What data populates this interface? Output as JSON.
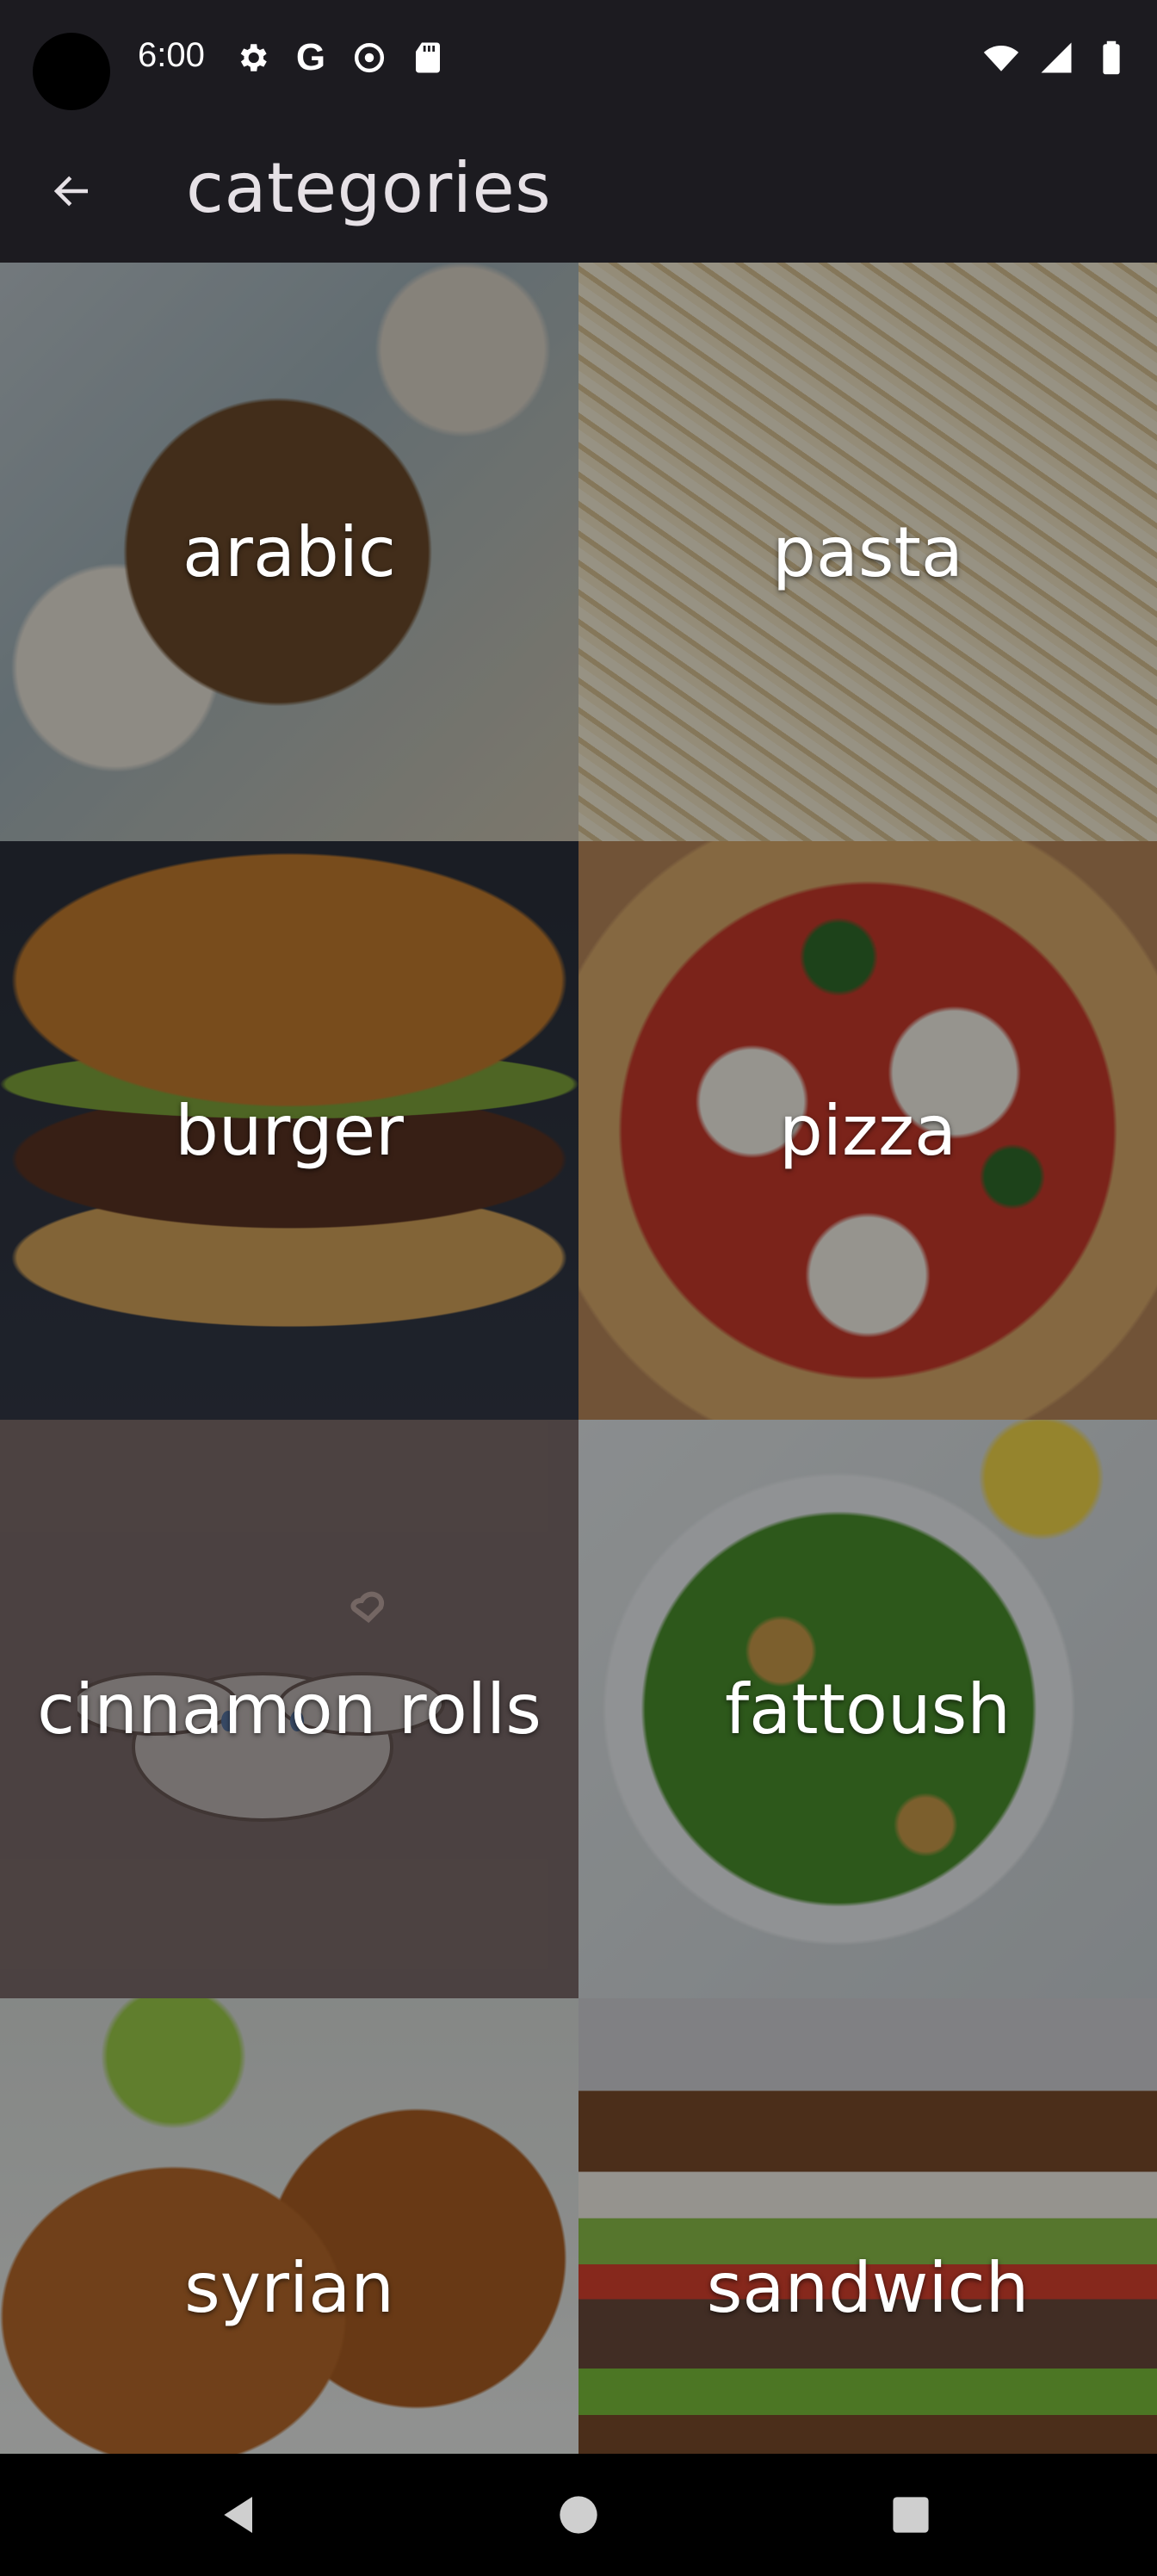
{
  "status_bar": {
    "time": "6:00",
    "left_icons": [
      "gear-icon",
      "google-icon",
      "settings-badge-icon",
      "sd-card-icon"
    ],
    "right_icons": [
      "wifi-icon",
      "signal-icon",
      "battery-icon"
    ]
  },
  "app_bar": {
    "title": "categories",
    "back_icon": "arrow-left-icon"
  },
  "categories": [
    {
      "id": "arabic",
      "label": "arabic"
    },
    {
      "id": "pasta",
      "label": "pasta"
    },
    {
      "id": "burger",
      "label": "burger"
    },
    {
      "id": "pizza",
      "label": "pizza"
    },
    {
      "id": "cinnamon",
      "label": "cinnamon rolls"
    },
    {
      "id": "fattoush",
      "label": "fattoush"
    },
    {
      "id": "syrian",
      "label": "syrian"
    },
    {
      "id": "sandwich",
      "label": "sandwich"
    }
  ],
  "nav_bar": {
    "icons": [
      "nav-back-icon",
      "nav-home-icon",
      "nav-recents-icon"
    ]
  },
  "colors": {
    "surface": "#1c1b20",
    "title_text": "#e6e1e6",
    "tile_text": "#ffffff",
    "nav_bar": "#000000"
  }
}
